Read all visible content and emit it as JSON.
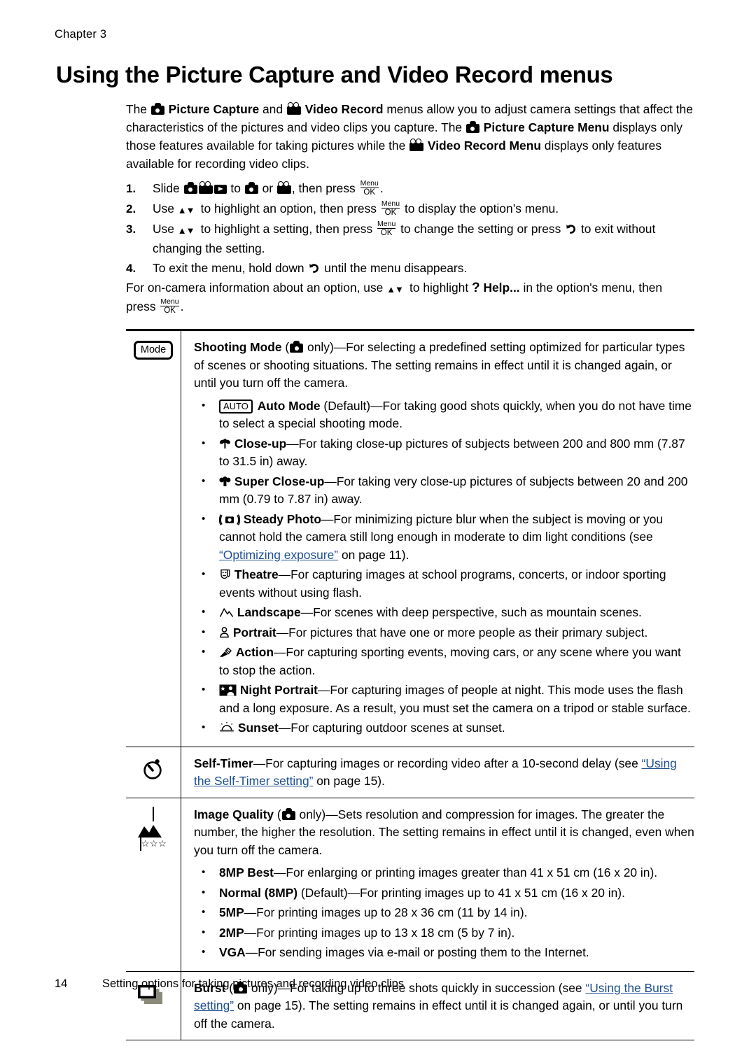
{
  "header": {
    "chapter": "Chapter 3"
  },
  "title": "Using the Picture Capture and Video Record menus",
  "intro": {
    "p1_a": "The ",
    "p1_b": "Picture Capture",
    "p1_c": " and ",
    "p1_d": "Video Record",
    "p1_e": " menus allow you to adjust camera settings that affect the characteristics of the pictures and video clips you capture. The ",
    "p1_f": "Picture Capture Menu",
    "p1_g": " displays only those features available for taking pictures while the ",
    "p1_h": "Video Record Menu",
    "p1_i": " displays only features available for recording video clips."
  },
  "steps": [
    {
      "num": "1.",
      "a": "Slide",
      "b": "to",
      "c": "or",
      "d": ", then press",
      "e": "."
    },
    {
      "num": "2.",
      "a": "Use",
      "b": "to highlight an option, then press",
      "c": "to display the option’s menu."
    },
    {
      "num": "3.",
      "a": "Use",
      "b": "to highlight a setting, then press",
      "c": "to change the setting or press",
      "d": "to exit without changing the setting."
    },
    {
      "num": "4.",
      "a": "To exit the menu, hold down",
      "b": "until the menu disappears."
    }
  ],
  "help_para": {
    "a": "For on-camera information about an option, use",
    "b": "to highlight",
    "c": "Help...",
    "d": "in the option's menu, then press",
    "e": "."
  },
  "menu_ok": {
    "top": "Menu",
    "bottom": "OK"
  },
  "settings": [
    {
      "icon_name": "mode-button-icon",
      "icon_label": "Mode",
      "title": "Shooting Mode",
      "scope_prefix": "(",
      "scope_suffix": " only)",
      "body": "—For selecting a predefined setting optimized for particular types of scenes or shooting situations. The setting remains in effect until it is changed again, or until you turn off the camera.",
      "bullets": [
        {
          "icon": "auto-badge",
          "icon_label": "AUTO",
          "name": "Auto Mode",
          "qualifier": " (Default)",
          "text": "—For taking good shots quickly, when you do not have time to select a special shooting mode."
        },
        {
          "icon": "flower-icon",
          "icon_label": "☘",
          "name": "Close-up",
          "qualifier": "",
          "text": "—For taking close-up pictures of subjects between 200 and 800 mm (7.87 to 31.5 in) away."
        },
        {
          "icon": "double-flower-icon",
          "icon_label": "☘",
          "name": "Super Close-up",
          "qualifier": "",
          "text": "—For taking very close-up pictures of subjects between 20 and 200 mm (0.79 to 7.87 in) away."
        },
        {
          "icon": "steady-photo-icon",
          "icon_label": "((■))",
          "name": "Steady Photo",
          "qualifier": "",
          "text": "—For minimizing picture blur when the subject is moving or you cannot hold the camera still long enough in moderate to dim light conditions (see ",
          "link": "“Optimizing exposure”",
          "text2": " on page 11)."
        },
        {
          "icon": "theatre-masks-icon",
          "icon_label": "☺",
          "name": "Theatre",
          "qualifier": "",
          "text": "—For capturing images at school programs, concerts, or indoor sporting events without using flash."
        },
        {
          "icon": "landscape-icon",
          "icon_label": "⛰",
          "name": "Landscape",
          "qualifier": "",
          "text": "—For scenes with deep perspective, such as mountain scenes."
        },
        {
          "icon": "portrait-icon",
          "icon_label": "♟",
          "name": "Portrait",
          "qualifier": "",
          "text": "—For pictures that have one or more people as their primary subject."
        },
        {
          "icon": "action-icon",
          "icon_label": "✒",
          "name": "Action",
          "qualifier": "",
          "text": "—For capturing sporting events, moving cars, or any scene where you want to stop the action."
        },
        {
          "icon": "night-portrait-icon",
          "icon_label": "★",
          "name": "Night Portrait",
          "qualifier": "",
          "text": "—For capturing images of people at night. This mode uses the flash and a long exposure. As a result, you must set the camera on a tripod or stable surface."
        },
        {
          "icon": "sunset-icon",
          "icon_label": "☀",
          "name": "Sunset",
          "qualifier": "",
          "text": "—For capturing outdoor scenes at sunset."
        }
      ]
    },
    {
      "icon_name": "self-timer-icon",
      "title": "Self-Timer",
      "body_a": "—For capturing images or recording video after a 10-second delay (see ",
      "link": "“Using the Self-Timer setting”",
      "body_b": " on page 15)."
    },
    {
      "icon_name": "image-quality-icon",
      "icon_stars": "☆☆☆",
      "title": "Image Quality",
      "scope_prefix": "(",
      "scope_suffix": " only)",
      "body": "—Sets resolution and compression for images. The greater the number, the higher the resolution. The setting remains in effect until it is changed, even when you turn off the camera.",
      "bullets": [
        {
          "name": "8MP Best",
          "qualifier": "",
          "text": "—For enlarging or printing images greater than 41 x 51 cm (16 x 20 in)."
        },
        {
          "name": "Normal (8MP)",
          "qualifier": " (Default)",
          "text": "—For printing images up to 41 x 51 cm (16 x 20 in)."
        },
        {
          "name": "5MP",
          "qualifier": "",
          "text": "—For printing images up to 28 x 36 cm (11 by 14 in)."
        },
        {
          "name": "2MP",
          "qualifier": "",
          "text": "—For printing images up to 13 x 18 cm (5 by 7 in)."
        },
        {
          "name": "VGA",
          "qualifier": "",
          "text": "—For sending images via e-mail or posting them to the Internet."
        }
      ]
    },
    {
      "icon_name": "burst-icon",
      "title": "Burst",
      "scope_prefix": "(",
      "scope_suffix": " only)",
      "body_a": "—For taking up to three shots quickly in succession (see ",
      "link": "“Using the Burst setting”",
      "body_b": " on page 15). The setting remains in effect until it is changed again, or until you turn off the camera."
    }
  ],
  "footer": {
    "page_number": "14",
    "text": "Setting options for taking pictures and recording video clips"
  },
  "colors": {
    "link": "#1d4f91",
    "text": "#000000",
    "background": "#ffffff"
  }
}
